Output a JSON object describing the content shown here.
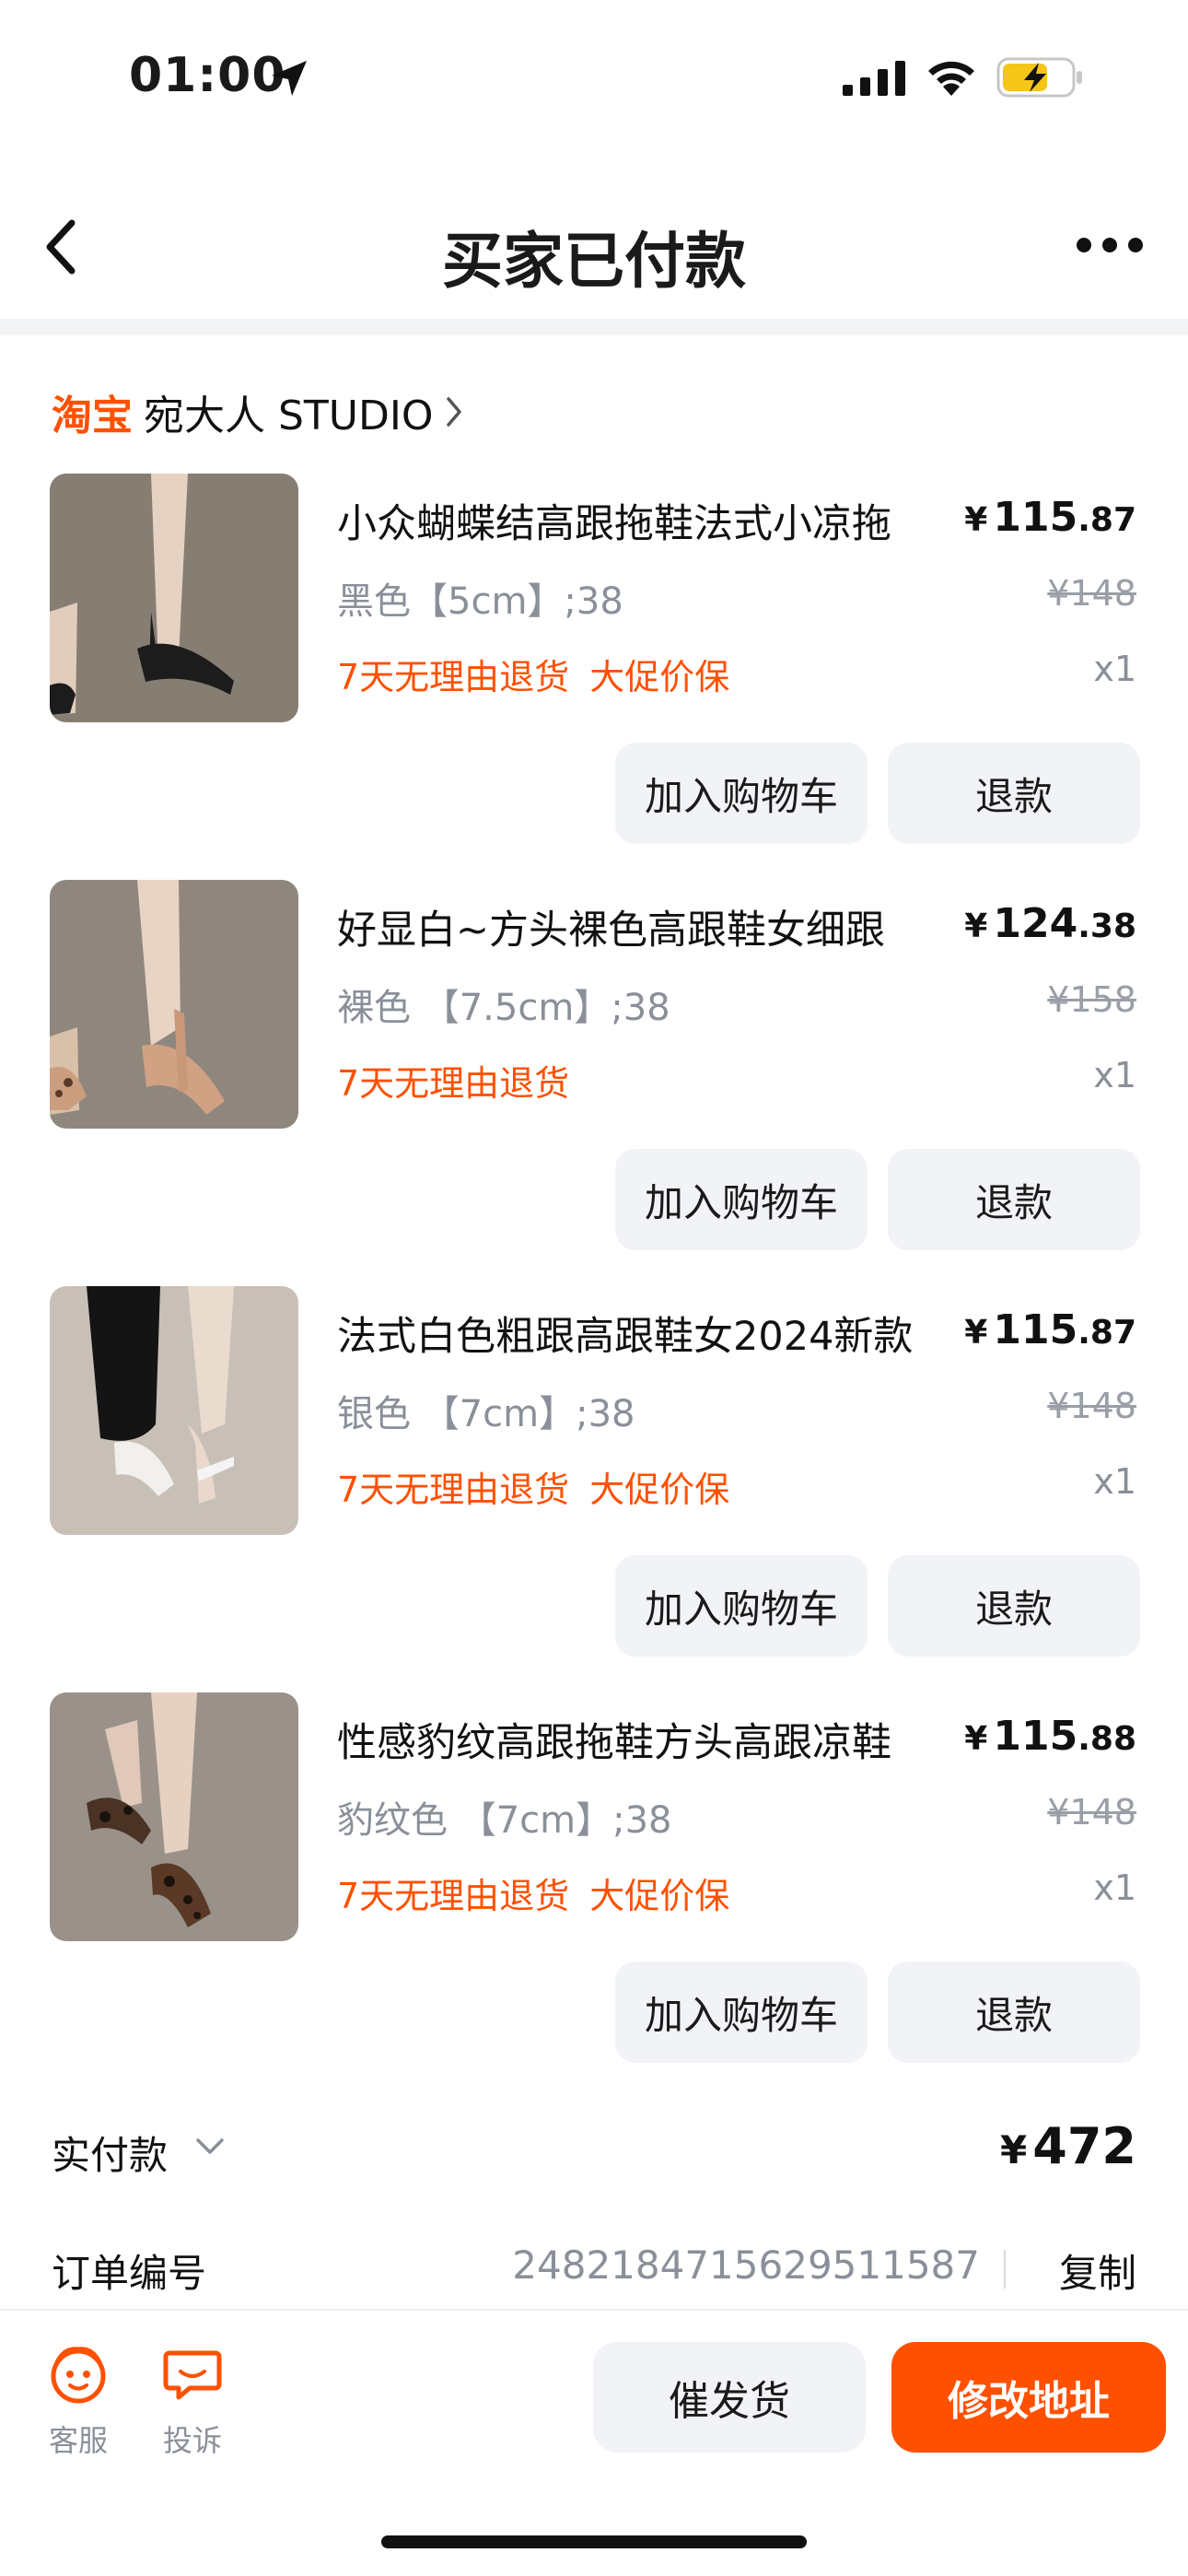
{
  "status_bar": {
    "time": "01:00"
  },
  "nav": {
    "title": "买家已付款"
  },
  "shop": {
    "logo_text": "淘宝",
    "name": "宛大人 STUDIO"
  },
  "items": [
    {
      "title": "小众蝴蝶结高跟拖鞋法式小凉拖",
      "price_yen": "¥",
      "price_int": "115",
      "price_cents": ".87",
      "spec": "黑色【5cm】;38",
      "original_price": "¥148",
      "tags": [
        "7天无理由退货",
        "大促价保"
      ],
      "qty": "x1",
      "cart_label": "加入购物车",
      "refund_label": "退款",
      "image": "black-heel-slipper-photo"
    },
    {
      "title": "好显白~方头裸色高跟鞋女细跟",
      "price_yen": "¥",
      "price_int": "124",
      "price_cents": ".38",
      "spec": "裸色 【7.5cm】;38",
      "original_price": "¥158",
      "tags": [
        "7天无理由退货"
      ],
      "qty": "x1",
      "cart_label": "加入购物车",
      "refund_label": "退款",
      "image": "nude-heel-photo"
    },
    {
      "title": "法式白色粗跟高跟鞋女2024新款",
      "price_yen": "¥",
      "price_int": "115",
      "price_cents": ".87",
      "spec": "银色 【7cm】;38",
      "original_price": "¥148",
      "tags": [
        "7天无理由退货",
        "大促价保"
      ],
      "qty": "x1",
      "cart_label": "加入购物车",
      "refund_label": "退款",
      "image": "white-heel-photo"
    },
    {
      "title": "性感豹纹高跟拖鞋方头高跟凉鞋",
      "price_yen": "¥",
      "price_int": "115",
      "price_cents": ".88",
      "spec": "豹纹色 【7cm】;38",
      "original_price": "¥148",
      "tags": [
        "7天无理由退货",
        "大促价保"
      ],
      "qty": "x1",
      "cart_label": "加入购物车",
      "refund_label": "退款",
      "image": "leopard-heel-photo"
    }
  ],
  "payment": {
    "label": "实付款",
    "yen": "¥",
    "amount": "472"
  },
  "order": {
    "label": "订单编号",
    "number": "2482184715629511587",
    "copy_label": "复制"
  },
  "bottom": {
    "service_label": "客服",
    "complain_label": "投诉",
    "urge_label": "催发货",
    "address_label": "修改地址"
  },
  "colors": {
    "accent": "#ff5000",
    "muted": "#8a8f99",
    "button_bg": "#f1f3f6"
  }
}
